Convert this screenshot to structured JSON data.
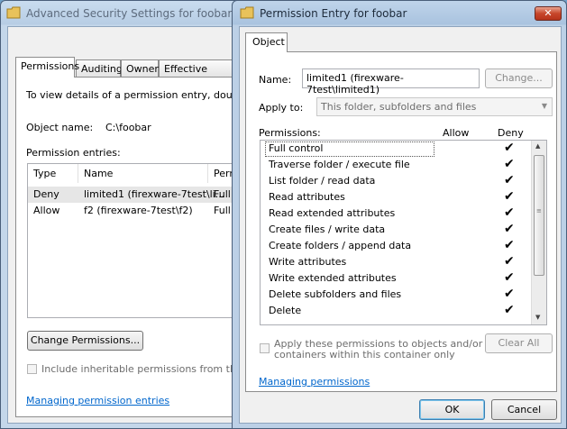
{
  "background_window": {
    "title": "Advanced Security Settings for foobar",
    "tabs": [
      "Permissions",
      "Auditing",
      "Owner",
      "Effective Permis"
    ],
    "instruction": "To view details of a permission entry, double-click",
    "object_name_label": "Object name:",
    "object_name_value": "C:\\foobar",
    "permission_entries_label": "Permission entries:",
    "columns": [
      "Type",
      "Name",
      "Perm"
    ],
    "entries": [
      {
        "type": "Deny",
        "name": "limited1 (firexware-7test\\li...",
        "perm": "Full c"
      },
      {
        "type": "Allow",
        "name": "f2 (firexware-7test\\f2)",
        "perm": "Full c"
      }
    ],
    "change_permissions_button": "Change Permissions...",
    "inherit_checkbox_label": "Include inheritable permissions from this objec",
    "managing_link": "Managing permission entries"
  },
  "dialog": {
    "title": "Permission Entry for foobar",
    "close_glyph": "✕",
    "tab": "Object",
    "name_label": "Name:",
    "name_value": "limited1 (firexware-7test\\limited1)",
    "change_button": "Change...",
    "apply_to_label": "Apply to:",
    "apply_to_value": "This folder, subfolders and files",
    "permissions_label": "Permissions:",
    "allow_header": "Allow",
    "deny_header": "Deny",
    "check_glyph": "✔",
    "permissions": [
      {
        "name": "Full control",
        "deny": true
      },
      {
        "name": "Traverse folder / execute file",
        "deny": true
      },
      {
        "name": "List folder / read data",
        "deny": true
      },
      {
        "name": "Read attributes",
        "deny": true
      },
      {
        "name": "Read extended attributes",
        "deny": true
      },
      {
        "name": "Create files / write data",
        "deny": true
      },
      {
        "name": "Create folders / append data",
        "deny": true
      },
      {
        "name": "Write attributes",
        "deny": true
      },
      {
        "name": "Write extended attributes",
        "deny": true
      },
      {
        "name": "Delete subfolders and files",
        "deny": true
      },
      {
        "name": "Delete",
        "deny": true
      }
    ],
    "apply_checkbox_line1": "Apply these permissions to objects and/or",
    "apply_checkbox_line2": "containers within this container only",
    "clear_all_button": "Clear All",
    "managing_link": "Managing permissions",
    "ok_button": "OK",
    "cancel_button": "Cancel"
  }
}
